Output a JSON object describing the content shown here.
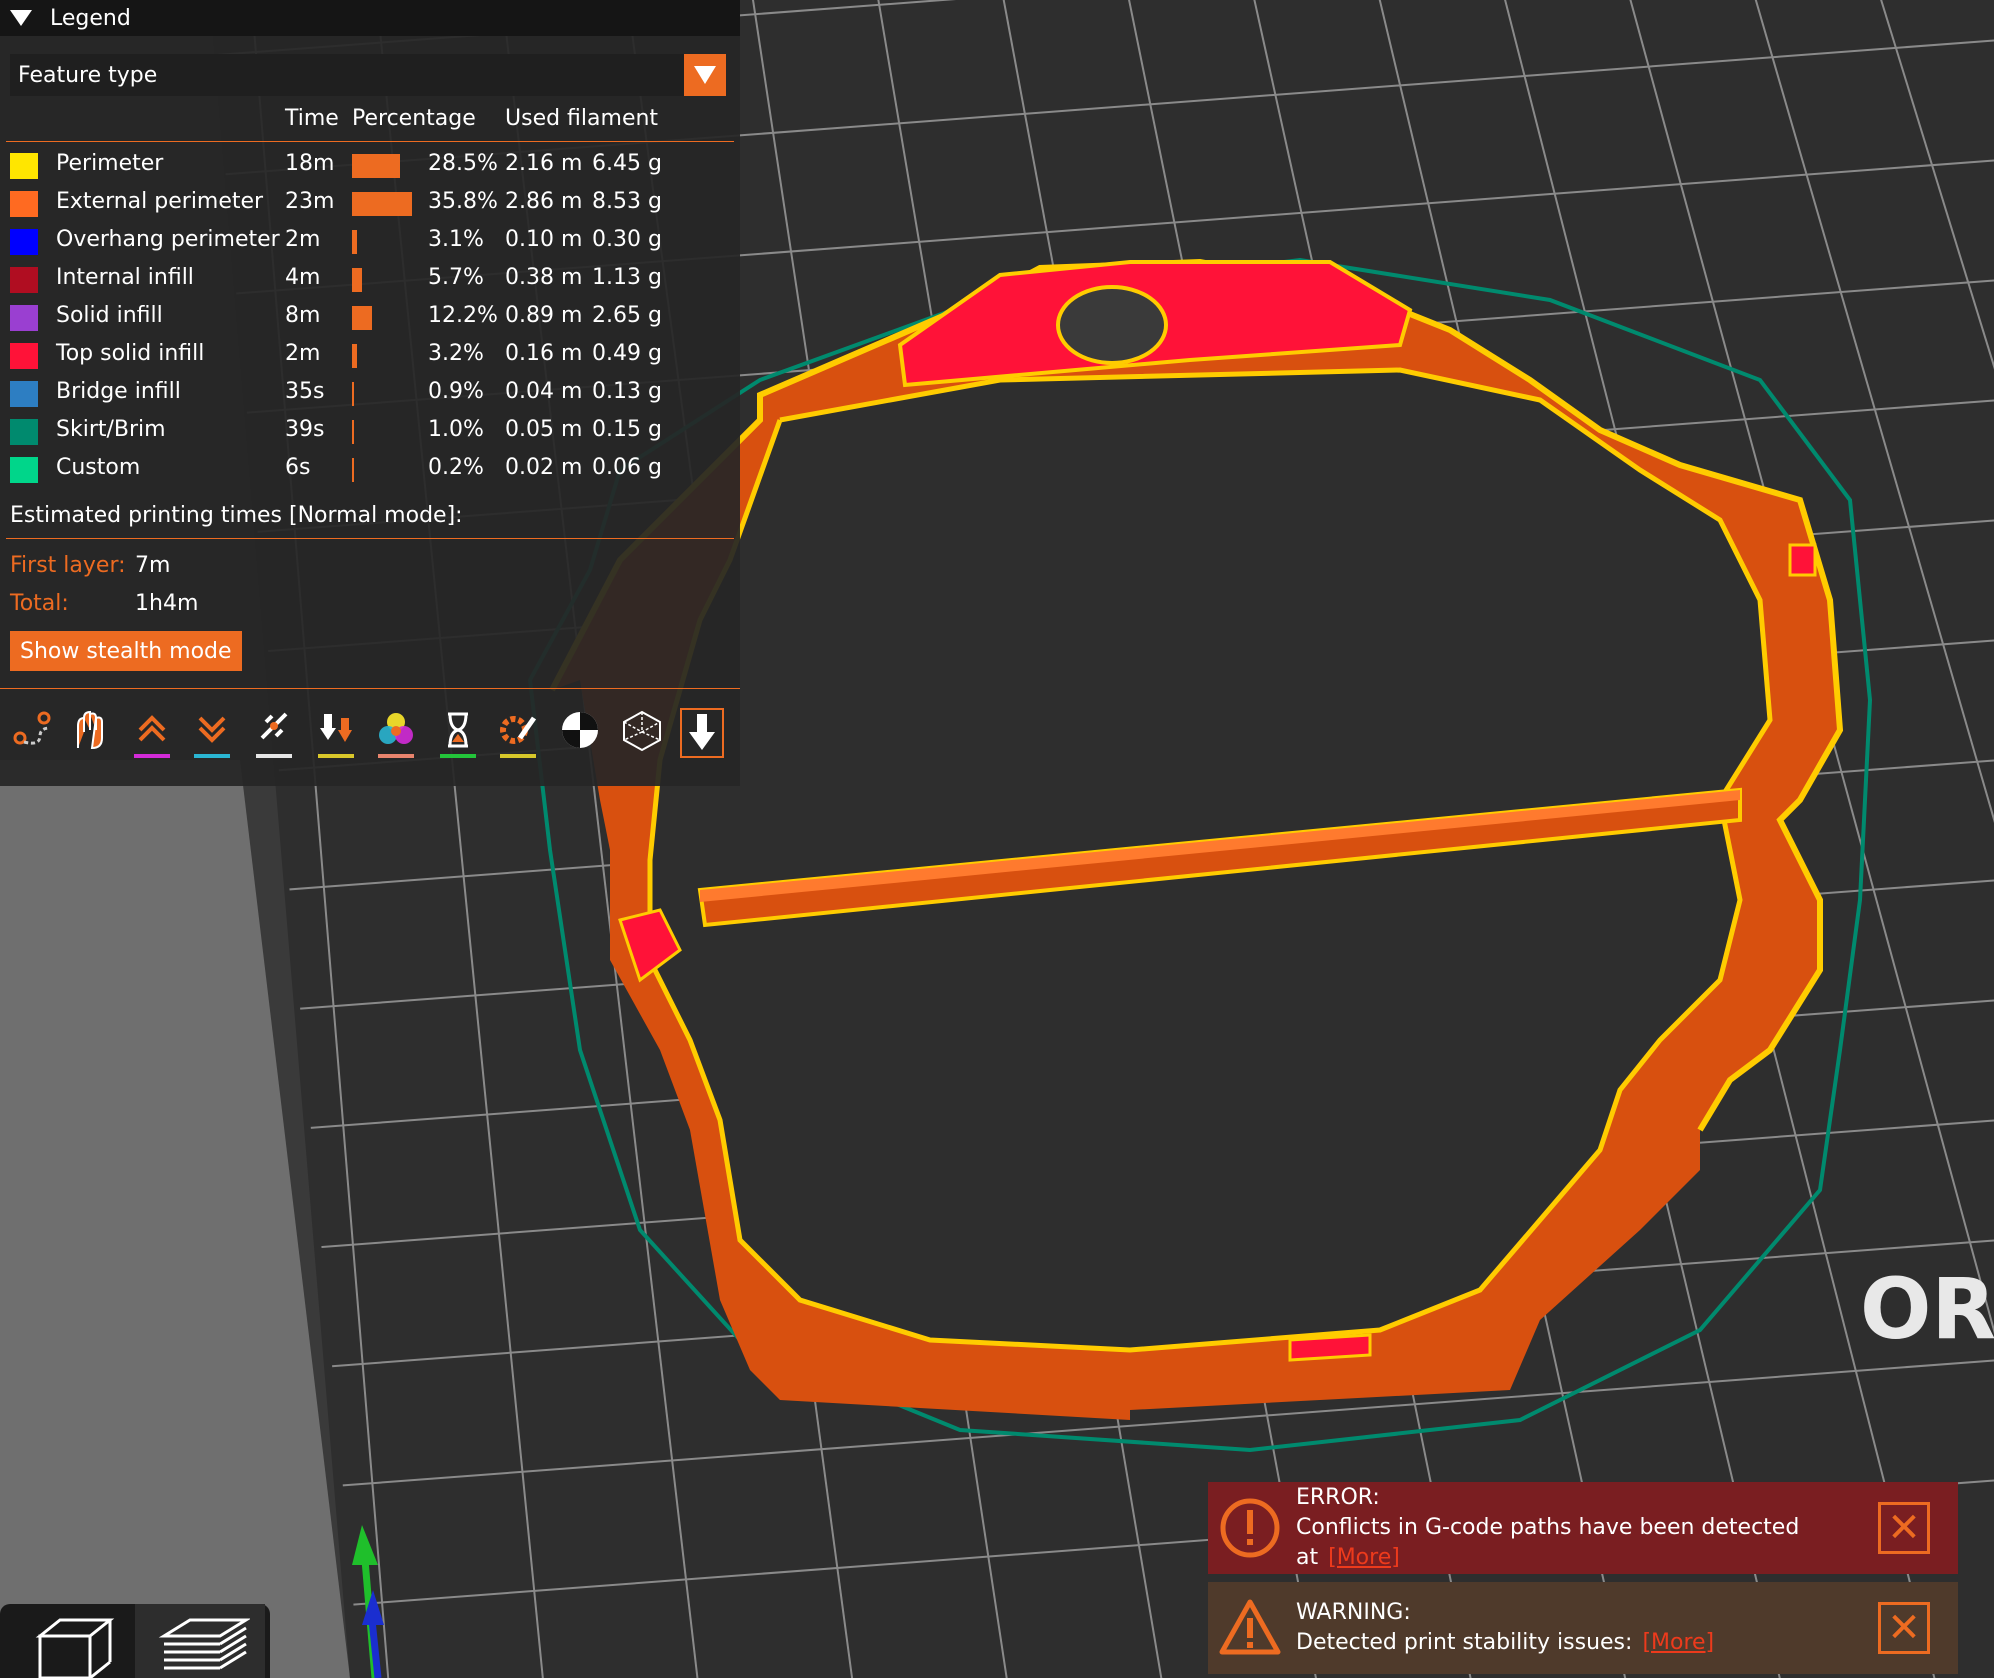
{
  "legend": {
    "title": "Legend",
    "view_type": "Feature type",
    "headers": {
      "time": "Time",
      "percentage": "Percentage",
      "used_filament": "Used filament"
    },
    "items": [
      {
        "name": "Perimeter",
        "color": "#ffe600",
        "time": "18m",
        "percentage": "28.5%",
        "length": "2.16 m",
        "mass": "6.45 g",
        "fraction": 0.285
      },
      {
        "name": "External perimeter",
        "color": "#ff6a21",
        "time": "23m",
        "percentage": "35.8%",
        "length": "2.86 m",
        "mass": "8.53 g",
        "fraction": 0.358
      },
      {
        "name": "Overhang perimeter",
        "color": "#0000ff",
        "time": "2m",
        "percentage": "3.1%",
        "length": "0.10 m",
        "mass": "0.30 g",
        "fraction": 0.031
      },
      {
        "name": "Internal infill",
        "color": "#b00d21",
        "time": "4m",
        "percentage": "5.7%",
        "length": "0.38 m",
        "mass": "1.13 g",
        "fraction": 0.057
      },
      {
        "name": "Solid infill",
        "color": "#9a3fd1",
        "time": "8m",
        "percentage": "12.2%",
        "length": "0.89 m",
        "mass": "2.65 g",
        "fraction": 0.122
      },
      {
        "name": "Top solid infill",
        "color": "#ff1238",
        "time": "2m",
        "percentage": "3.2%",
        "length": "0.16 m",
        "mass": "0.49 g",
        "fraction": 0.032
      },
      {
        "name": "Bridge infill",
        "color": "#2d7ec2",
        "time": "35s",
        "percentage": "0.9%",
        "length": "0.04 m",
        "mass": "0.13 g",
        "fraction": 0.009
      },
      {
        "name": "Skirt/Brim",
        "color": "#008a6e",
        "time": "39s",
        "percentage": "1.0%",
        "length": "0.05 m",
        "mass": "0.15 g",
        "fraction": 0.01
      },
      {
        "name": "Custom",
        "color": "#00d68a",
        "time": "6s",
        "percentage": "0.2%",
        "length": "0.02 m",
        "mass": "0.06 g",
        "fraction": 0.002
      }
    ],
    "estimated_label": "Estimated printing times [Normal mode]:",
    "first_layer_label": "First layer:",
    "first_layer_value": "7m",
    "total_label": "Total:",
    "total_value": "1h4m",
    "stealth_button": "Show stealth mode",
    "toolbar": [
      {
        "icon": "travel-icon",
        "underline": ""
      },
      {
        "icon": "wipe-icon",
        "underline": ""
      },
      {
        "icon": "retractions-icon",
        "underline": "#d32bd8"
      },
      {
        "icon": "deretractions-icon",
        "underline": "#2ab5d2"
      },
      {
        "icon": "seams-icon",
        "underline": "#e6e6e6"
      },
      {
        "icon": "tool-changes-icon",
        "underline": "#d9c72a"
      },
      {
        "icon": "color-changes-icon",
        "underline": "#e8846d"
      },
      {
        "icon": "pause-prints-icon",
        "underline": "#23c43a"
      },
      {
        "icon": "custom-gcodes-icon",
        "underline": "#d6c72a"
      },
      {
        "icon": "center-of-gravity-icon",
        "underline": ""
      },
      {
        "icon": "shells-icon",
        "underline": ""
      },
      {
        "icon": "tool-marker-icon",
        "underline": ""
      }
    ]
  },
  "scene": {
    "bed_label": "OR"
  },
  "notifications": {
    "error": {
      "title": "ERROR:",
      "text": "Conflicts in G-code paths have been detected at",
      "more": "[More]"
    },
    "warning": {
      "title": "WARNING:",
      "text": "Detected print stability issues:",
      "more": "[More]"
    }
  },
  "views": [
    {
      "icon": "3d-view-icon"
    },
    {
      "icon": "preview-layers-icon"
    }
  ]
}
